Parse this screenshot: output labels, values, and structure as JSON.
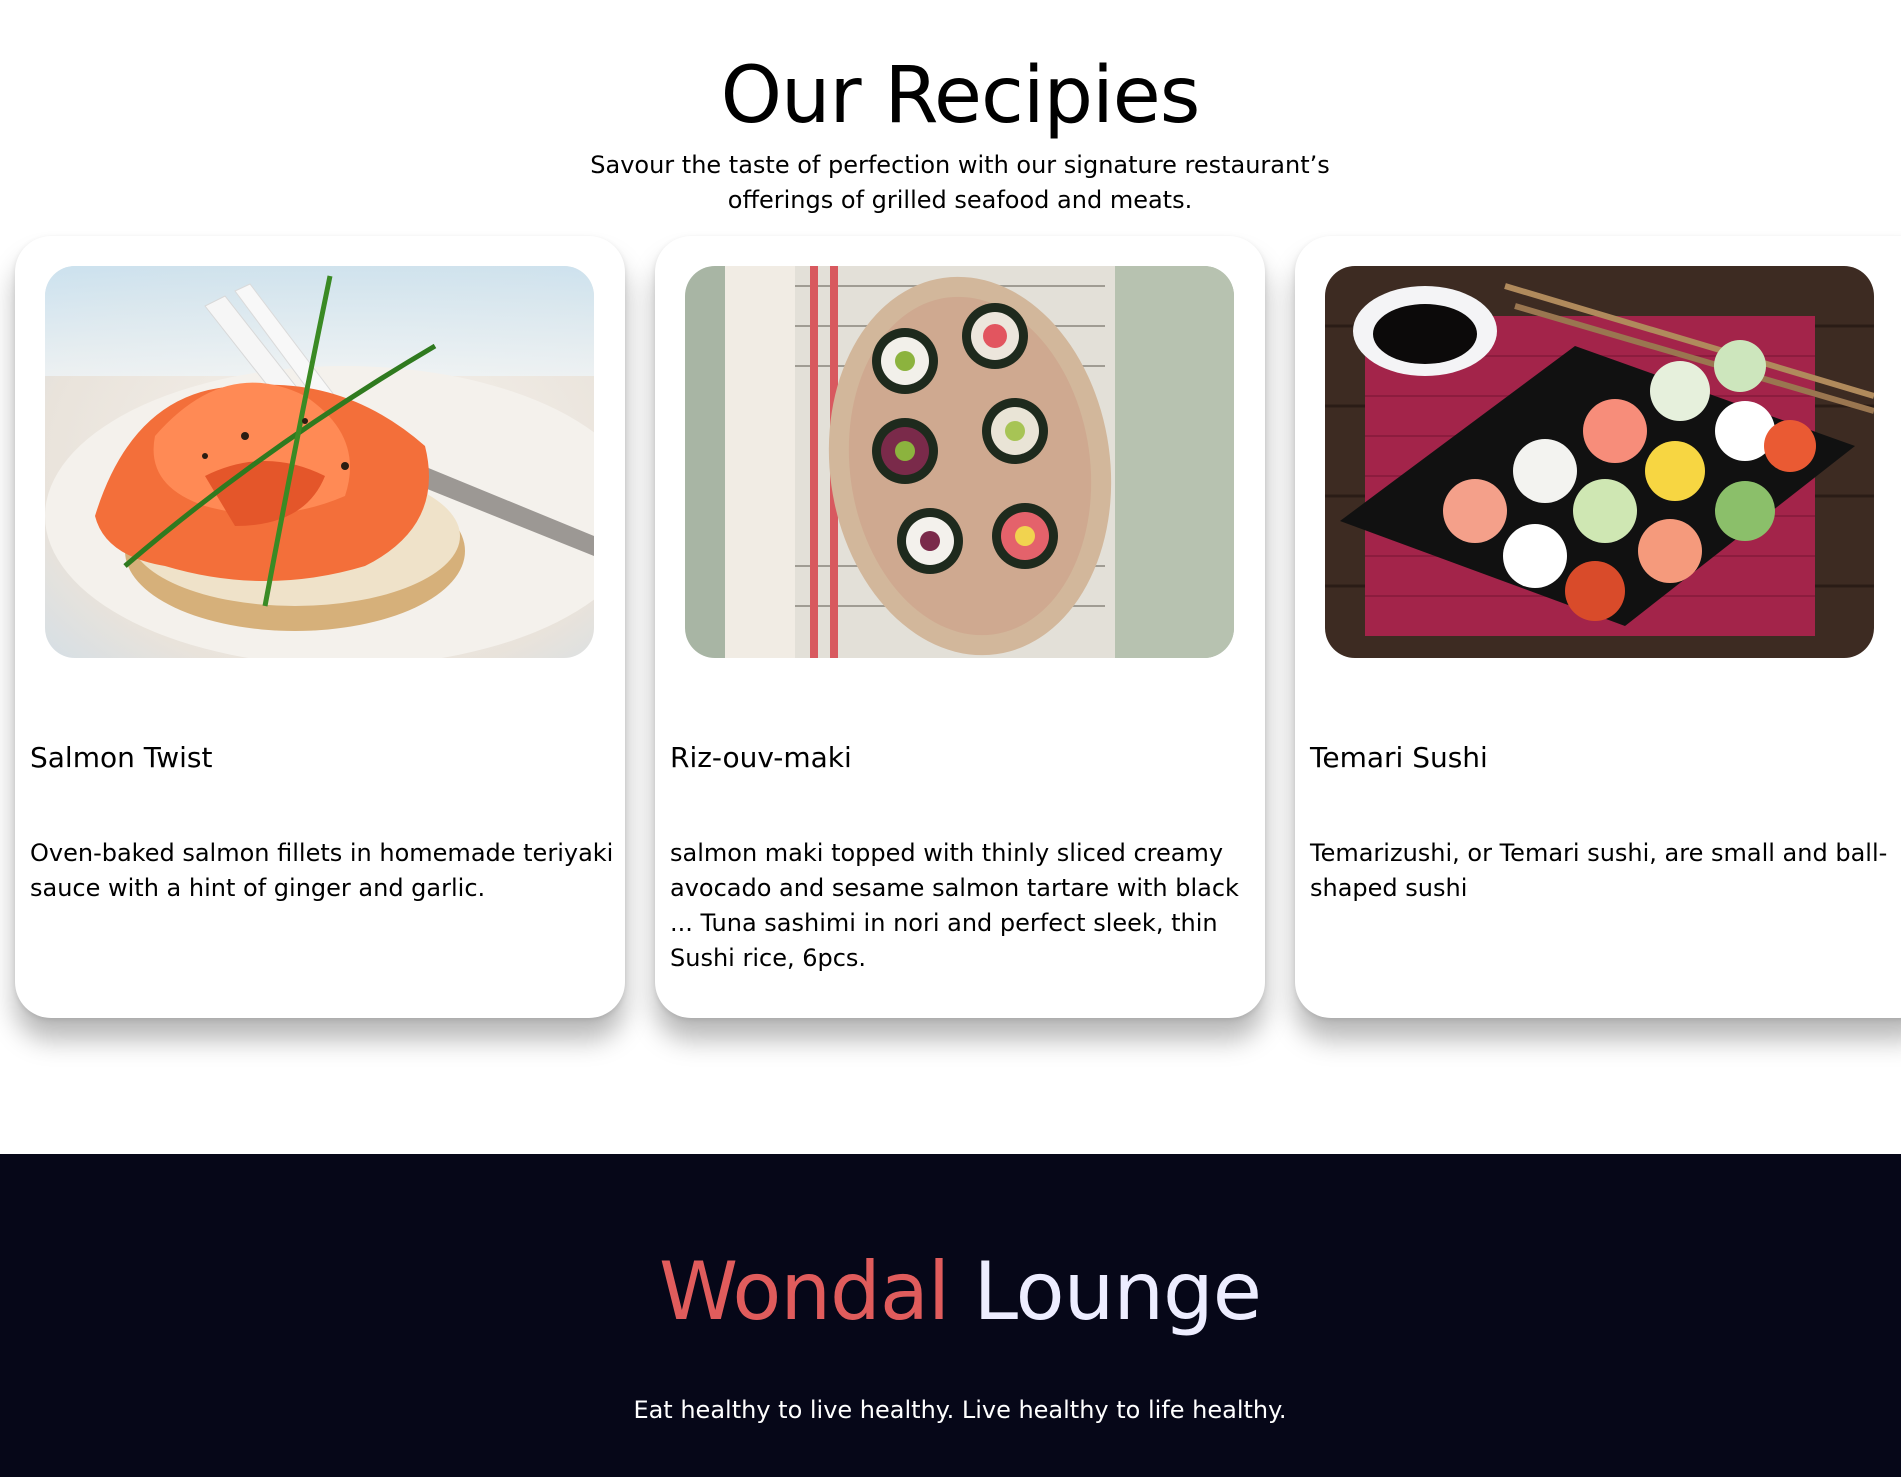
{
  "recipes": {
    "title": "Our Recipies",
    "subtitle": "Savour the taste of perfection with our signature restaurant’s offerings of grilled seafood and meats.",
    "cards": [
      {
        "name": "Salmon Twist",
        "description": "Oven-baked salmon fillets in homemade teriyaki sauce with a hint of ginger and garlic."
      },
      {
        "name": "Riz-ouv-maki",
        "description": "salmon maki topped with thinly sliced creamy avocado and sesame salmon tartare with black ... Tuna sashimi in nori and perfect sleek, thin Sushi rice, 6pcs."
      },
      {
        "name": "Temari Sushi",
        "description": "Temarizushi, or Temari sushi, are small and ball-shaped sushi"
      }
    ]
  },
  "footer": {
    "brand_first": "Wondal",
    "brand_second": "Lounge",
    "tagline": "Eat healthy to live healthy. Live healthy to life healthy.",
    "colors": {
      "background": "#060718",
      "brand_accent": "#e05c5c",
      "brand_light": "#ededff"
    }
  }
}
